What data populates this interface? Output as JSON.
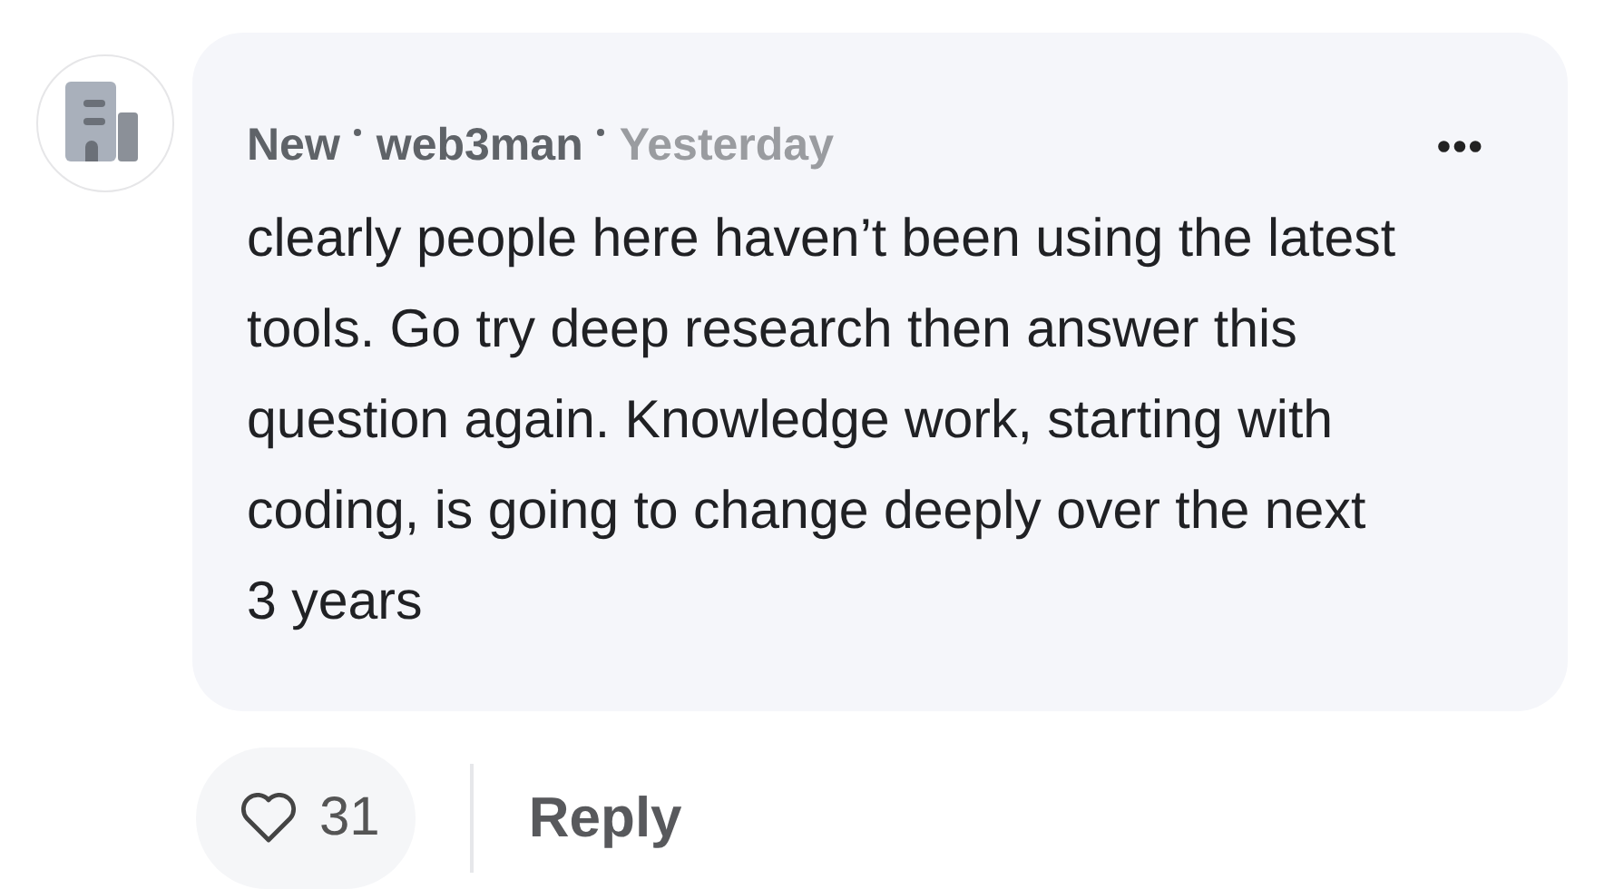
{
  "comment": {
    "badge": "New",
    "author": "web3man",
    "time": "Yesterday",
    "menu": "•••",
    "text": "clearly people here haven’t been using the latest tools. Go try deep research then answer this question again. Knowledge work, starting with coding, is going to change deeply over the next 3 years"
  },
  "actions": {
    "like_count": "31",
    "liked": false,
    "reply": "Reply"
  }
}
